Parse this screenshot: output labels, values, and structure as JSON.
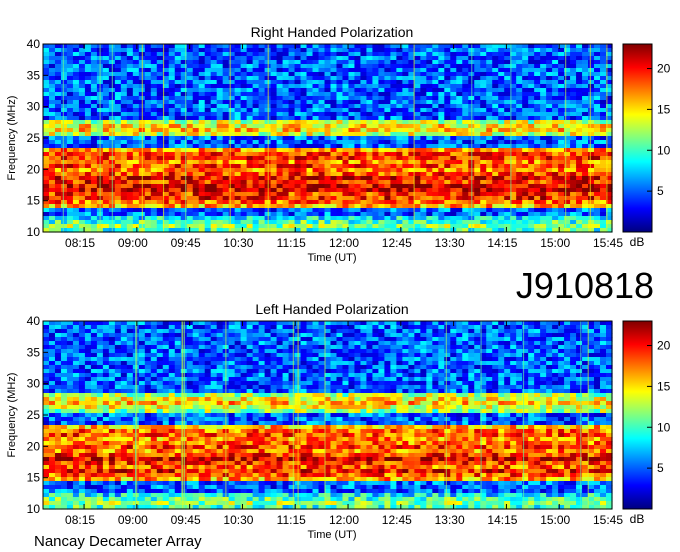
{
  "figure": {
    "id_label": "J910818",
    "footer": "Nancay Decameter Array"
  },
  "chart_data": [
    {
      "type": "heatmap",
      "title": "Right Handed Polarization",
      "xlabel": "Time (UT)",
      "ylabel": "Frequency (MHz)",
      "x_ticks": [
        "08:15",
        "09:00",
        "09:45",
        "10:30",
        "11:15",
        "12:00",
        "12:45",
        "13:30",
        "14:15",
        "15:00",
        "15:45"
      ],
      "xlim": [
        "07:40",
        "15:45"
      ],
      "ylim": [
        10,
        40
      ],
      "y_ticks": [
        10,
        15,
        20,
        25,
        30,
        35,
        40
      ],
      "colorbar": {
        "label": "dB",
        "range": [
          0,
          23
        ],
        "ticks": [
          5,
          10,
          15,
          20
        ],
        "colormap": "jet"
      },
      "bands_mhz": [
        {
          "f": 26.5,
          "level": 16
        },
        {
          "f": 22.0,
          "level": 20
        },
        {
          "f": 20.5,
          "level": 19
        },
        {
          "f": 18.5,
          "level": 21
        },
        {
          "f": 17.0,
          "level": 22
        },
        {
          "f": 15.5,
          "level": 20
        },
        {
          "f": 11.0,
          "level": 12
        }
      ]
    },
    {
      "type": "heatmap",
      "title": "Left Handed Polarization",
      "xlabel": "Time (UT)",
      "ylabel": "Frequency (MHz)",
      "x_ticks": [
        "08:15",
        "09:00",
        "09:45",
        "10:30",
        "11:15",
        "12:00",
        "12:45",
        "13:30",
        "14:15",
        "15:00",
        "15:45"
      ],
      "xlim": [
        "07:40",
        "15:45"
      ],
      "ylim": [
        10,
        40
      ],
      "y_ticks": [
        10,
        15,
        20,
        25,
        30,
        35,
        40
      ],
      "colorbar": {
        "label": "dB",
        "range": [
          0,
          23
        ],
        "ticks": [
          5,
          10,
          15,
          20
        ],
        "colormap": "jet"
      },
      "bands_mhz": [
        {
          "f": 27.0,
          "level": 16
        },
        {
          "f": 22.0,
          "level": 19
        },
        {
          "f": 20.0,
          "level": 19
        },
        {
          "f": 18.0,
          "level": 21
        },
        {
          "f": 16.0,
          "level": 20
        },
        {
          "f": 11.0,
          "level": 12
        }
      ]
    }
  ]
}
